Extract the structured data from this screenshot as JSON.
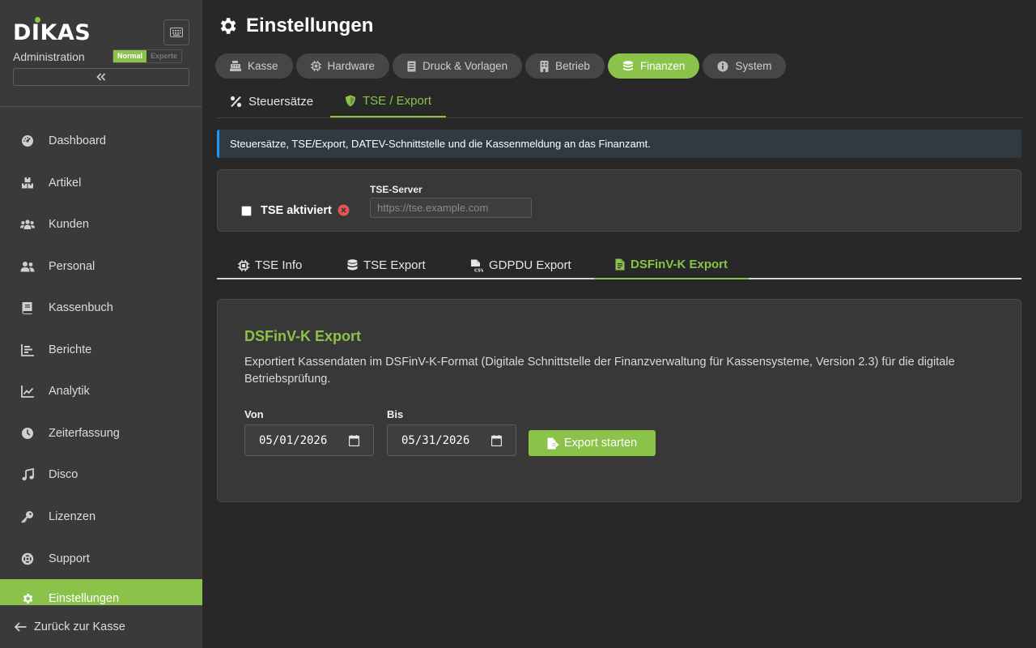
{
  "app": {
    "logo": "DIKAS",
    "subtitle": "Administration",
    "mode_normal": "Normal",
    "mode_expert": "Experte",
    "accent": "#8bc34a"
  },
  "sidebar": {
    "items": [
      {
        "label": "Dashboard",
        "icon": "dashboard-icon"
      },
      {
        "label": "Artikel",
        "icon": "boxes-icon"
      },
      {
        "label": "Kunden",
        "icon": "users-icon"
      },
      {
        "label": "Personal",
        "icon": "user-group-icon"
      },
      {
        "label": "Kassenbuch",
        "icon": "book-icon"
      },
      {
        "label": "Berichte",
        "icon": "bar-chart-icon"
      },
      {
        "label": "Analytik",
        "icon": "line-chart-icon"
      },
      {
        "label": "Zeiterfassung",
        "icon": "clock-icon"
      },
      {
        "label": "Disco",
        "icon": "music-icon"
      },
      {
        "label": "Lizenzen",
        "icon": "key-icon"
      },
      {
        "label": "Support",
        "icon": "lifebuoy-icon"
      },
      {
        "label": "Einstellungen",
        "icon": "gear-icon",
        "active": true
      }
    ],
    "back_label": "Zurück zur Kasse"
  },
  "page": {
    "title": "Einstellungen",
    "pills": [
      {
        "label": "Kasse",
        "icon": "cash-register-icon"
      },
      {
        "label": "Hardware",
        "icon": "chip-icon"
      },
      {
        "label": "Druck & Vorlagen",
        "icon": "document-icon"
      },
      {
        "label": "Betrieb",
        "icon": "building-icon"
      },
      {
        "label": "Finanzen",
        "icon": "coins-icon",
        "active": true
      },
      {
        "label": "System",
        "icon": "info-icon"
      }
    ],
    "subtabs": [
      {
        "label": "Steuersätze",
        "icon": "percent-icon"
      },
      {
        "label": "TSE / Export",
        "icon": "shield-icon",
        "active": true
      }
    ],
    "info": "Steuersätze, TSE/Export, DATEV-Schnittstelle und die Kassenmeldung an das Finanzamt.",
    "tse": {
      "checkbox_label": "TSE aktiviert",
      "checked": false,
      "server_label": "TSE-Server",
      "server_placeholder": "https://tse.example.com",
      "server_value": ""
    },
    "export_tabs": [
      {
        "label": "TSE Info",
        "icon": "chip-icon"
      },
      {
        "label": "TSE Export",
        "icon": "database-icon"
      },
      {
        "label": "GDPDU Export",
        "icon": "csv-file-icon"
      },
      {
        "label": "DSFinV-K Export",
        "icon": "file-icon",
        "active": true
      }
    ],
    "export": {
      "title": "DSFinV-K Export",
      "description": "Exportiert Kassendaten im DSFinV-K-Format (Digitale Schnittstelle der Finanzverwaltung für Kassensysteme, Version 2.3) für die digitale Betriebsprüfung.",
      "from_label": "Von",
      "from_value": "05/01/2026",
      "to_label": "Bis",
      "to_value": "05/31/2026",
      "button": "Export starten"
    }
  }
}
